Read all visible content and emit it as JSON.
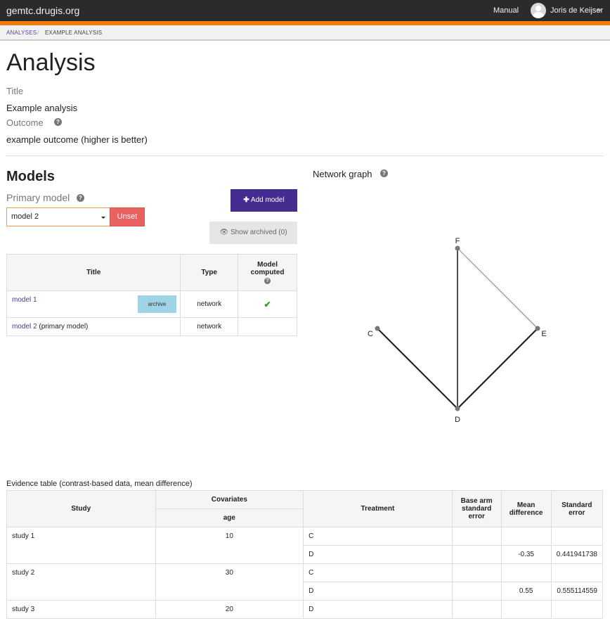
{
  "header": {
    "brand": "gemtc.drugis.org",
    "manual": "Manual",
    "user": "Joris de Keijser"
  },
  "breadcrumb": {
    "link": "ANALYSES",
    "separator": "/",
    "current": "EXAMPLE ANALYSIS"
  },
  "page": {
    "title": "Analysis",
    "title_label": "Title",
    "title_value": "Example analysis",
    "outcome_label": "Outcome",
    "outcome_value": "example outcome (higher is better)"
  },
  "models": {
    "heading": "Models",
    "primary_label": "Primary model",
    "select_value": "model 2",
    "unset_label": "Unset",
    "add_label": "Add model",
    "show_archived_label": "Show archived (0)",
    "columns": {
      "title": "Title",
      "type": "Type",
      "computed_line1": "Model",
      "computed_line2": "computed"
    },
    "rows": [
      {
        "title": "model 1",
        "suffix": "",
        "archive_label": "archive",
        "type": "network",
        "computed": true
      },
      {
        "title": "model 2",
        "suffix": "(primary model)",
        "type": "network",
        "computed": false
      }
    ]
  },
  "network": {
    "heading": "Network graph",
    "nodes": [
      "F",
      "C",
      "E",
      "D"
    ],
    "edges": [
      [
        "F",
        "D"
      ],
      [
        "F",
        "E"
      ],
      [
        "C",
        "D"
      ],
      [
        "E",
        "D"
      ]
    ]
  },
  "evidence": {
    "caption": "Evidence table (contrast-based data, mean difference)",
    "columns": {
      "study": "Study",
      "covariates": "Covariates",
      "age": "age",
      "treatment": "Treatment",
      "base_se_1": "Base arm",
      "base_se_2": "standard",
      "base_se_3": "error",
      "mean_diff_1": "Mean",
      "mean_diff_2": "difference",
      "std_err_1": "Standard",
      "std_err_2": "error"
    },
    "studies": [
      {
        "name": "study 1",
        "age": "10",
        "rows": [
          {
            "treatment": "C",
            "base_se": "",
            "mean_diff": "",
            "std_err": ""
          },
          {
            "treatment": "D",
            "base_se": "",
            "mean_diff": "-0.35",
            "std_err": "0.441941738"
          }
        ]
      },
      {
        "name": "study 2",
        "age": "30",
        "rows": [
          {
            "treatment": "C",
            "base_se": "",
            "mean_diff": "",
            "std_err": ""
          },
          {
            "treatment": "D",
            "base_se": "",
            "mean_diff": "0.55",
            "std_err": "0.555114559"
          }
        ]
      },
      {
        "name": "study 3",
        "age": "20",
        "rows": [
          {
            "treatment": "D",
            "base_se": "",
            "mean_diff": "",
            "std_err": ""
          }
        ]
      }
    ]
  },
  "colors": {
    "topbar": "#2b2b2b",
    "accent": "#f27b0c",
    "primary_button": "#442b8f",
    "danger_button": "#e8615f",
    "info_button": "#9fd3e6",
    "link": "#4a3a8f"
  }
}
